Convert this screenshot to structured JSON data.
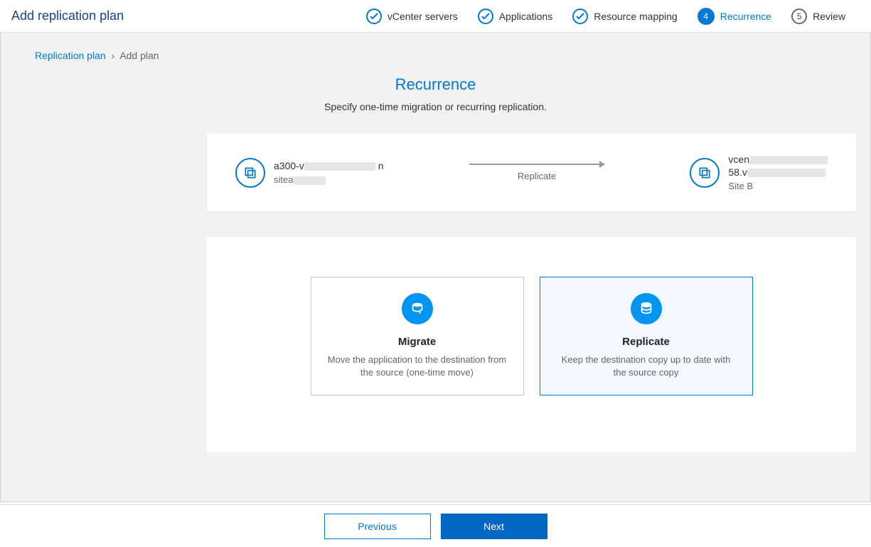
{
  "header": {
    "title": "Add replication plan",
    "steps": [
      {
        "label": "vCenter servers",
        "state": "done"
      },
      {
        "label": "Applications",
        "state": "done"
      },
      {
        "label": "Resource mapping",
        "state": "done"
      },
      {
        "label": "Recurrence",
        "state": "active",
        "num": "4"
      },
      {
        "label": "Review",
        "state": "pending",
        "num": "5"
      }
    ]
  },
  "breadcrumb": {
    "root": "Replication plan",
    "current": "Add plan"
  },
  "section": {
    "title": "Recurrence",
    "desc": "Specify one-time migration or recurring replication."
  },
  "flow": {
    "source": {
      "name_prefix": "a300-v",
      "site_prefix": "sitea"
    },
    "action": "Replicate",
    "target": {
      "name_prefix": "vcen",
      "name2_prefix": "58.v",
      "site": "Site B"
    }
  },
  "options": [
    {
      "key": "migrate",
      "title": "Migrate",
      "desc": "Move the application to the destination from the source (one-time move)",
      "selected": false
    },
    {
      "key": "replicate",
      "title": "Replicate",
      "desc": "Keep the destination copy up to date with the source copy",
      "selected": true
    }
  ],
  "footer": {
    "previous": "Previous",
    "next": "Next"
  }
}
